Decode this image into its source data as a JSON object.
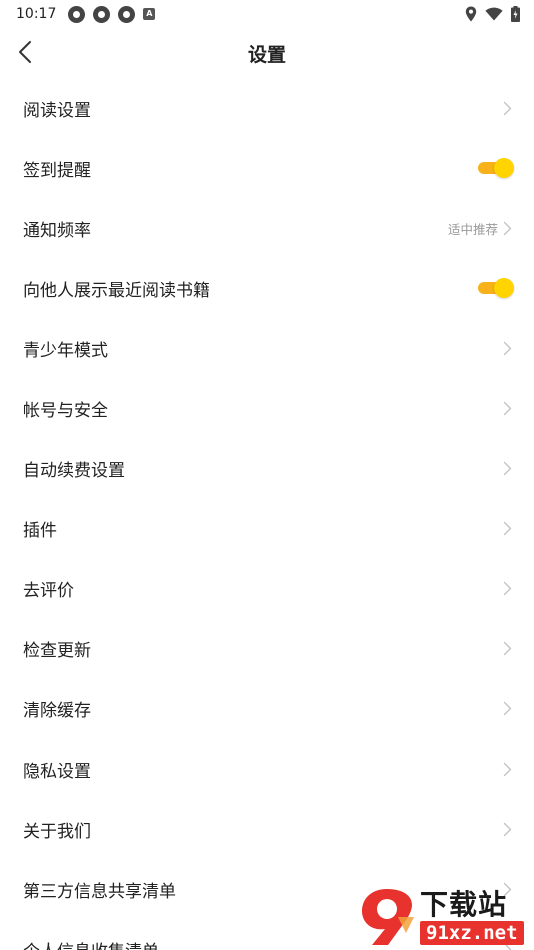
{
  "status_bar": {
    "time": "10:17",
    "left_icons": [
      "app-notification-icon",
      "app-notification-icon",
      "app-notification-icon",
      "a-badge-icon"
    ],
    "a_badge": "A",
    "right_icons": [
      "location-icon",
      "wifi-icon",
      "battery-icon"
    ]
  },
  "header": {
    "title": "设置",
    "back_icon": "chevron-left-icon"
  },
  "settings": {
    "items": [
      {
        "label": "阅读设置",
        "control": "chevron"
      },
      {
        "label": "签到提醒",
        "control": "toggle",
        "on": true
      },
      {
        "label": "通知频率",
        "control": "chevron",
        "value": "适中推荐"
      },
      {
        "label": "向他人展示最近阅读书籍",
        "control": "toggle",
        "on": true
      },
      {
        "label": "青少年模式",
        "control": "chevron"
      },
      {
        "label": "帐号与安全",
        "control": "chevron"
      },
      {
        "label": "自动续费设置",
        "control": "chevron"
      },
      {
        "label": "插件",
        "control": "chevron"
      },
      {
        "label": "去评价",
        "control": "chevron"
      },
      {
        "label": "检查更新",
        "control": "chevron"
      },
      {
        "label": "清除缓存",
        "control": "chevron"
      },
      {
        "label": "隐私设置",
        "control": "chevron"
      },
      {
        "label": "关于我们",
        "control": "chevron"
      },
      {
        "label": "第三方信息共享清单",
        "control": "chevron"
      },
      {
        "label": "个人信息收集清单",
        "control": "chevron"
      }
    ]
  },
  "watermark": {
    "title": "下载站",
    "domain": "91xz.net"
  },
  "colors": {
    "toggle_track": "#f7b21a",
    "toggle_knob": "#ffd400",
    "chevron": "#c4c4c4",
    "secondary_text": "#999999",
    "watermark_red": "#e8322d"
  }
}
